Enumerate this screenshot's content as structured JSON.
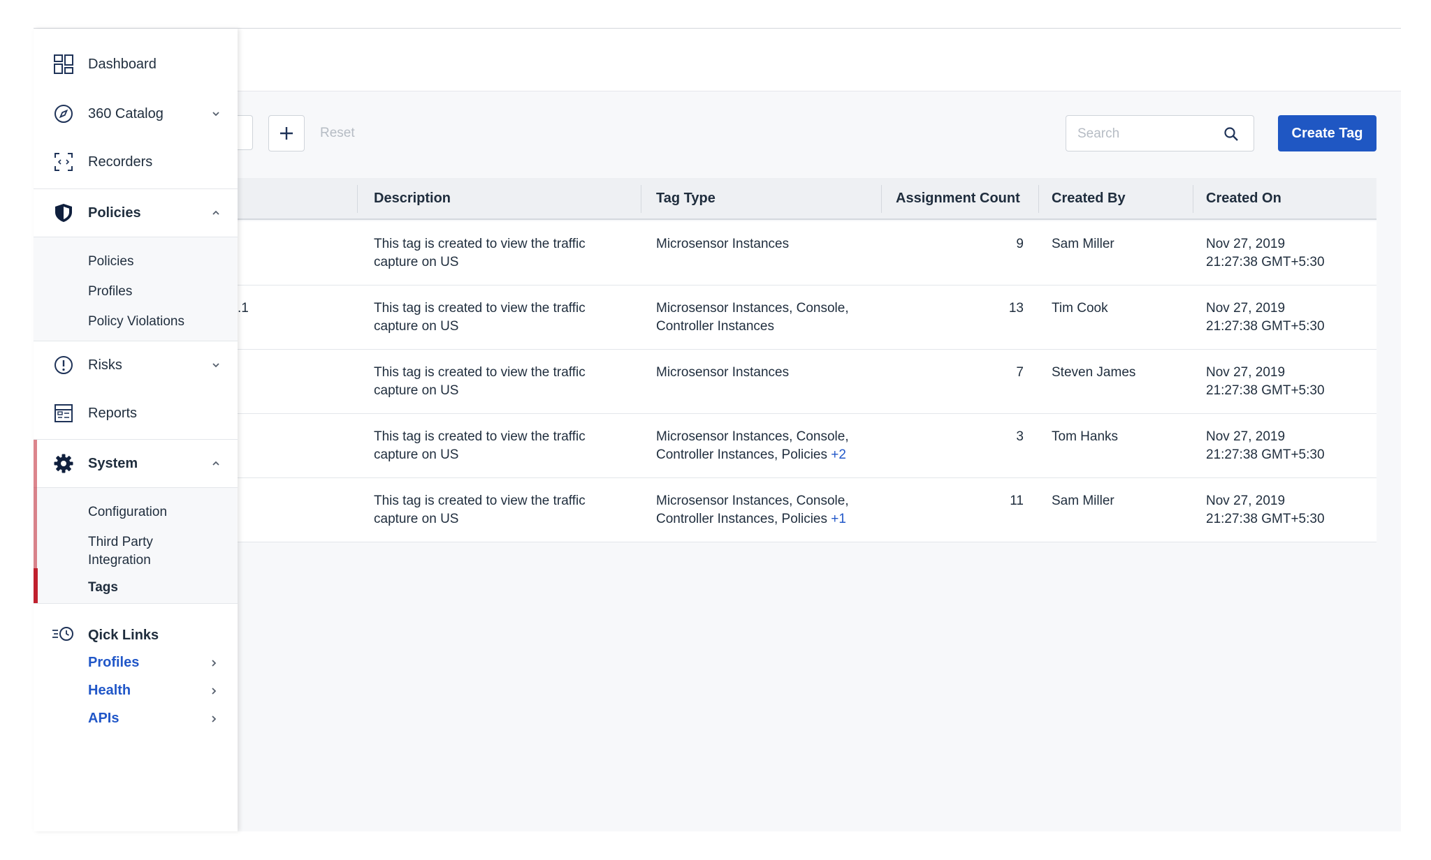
{
  "sidebar": {
    "items": [
      {
        "label": "Dashboard"
      },
      {
        "label": "360 Catalog"
      },
      {
        "label": "Recorders"
      },
      {
        "label": "Policies",
        "sub": [
          "Policies",
          "Profiles",
          "Policy Violations"
        ]
      },
      {
        "label": "Risks"
      },
      {
        "label": "Reports"
      },
      {
        "label": "System",
        "sub": [
          "Configuration",
          "Third Party",
          "Integration",
          "Tags"
        ]
      }
    ],
    "quick_links": {
      "title": "Qick Links",
      "items": [
        "Profiles",
        "Health",
        "APIs"
      ]
    }
  },
  "toolbar": {
    "reset_label": "Reset",
    "search_placeholder": "Search",
    "create_label": "Create Tag"
  },
  "table": {
    "columns": [
      "Description",
      "Tag Type",
      "Assignment Count",
      "Created By",
      "Created On"
    ],
    "rows": [
      {
        "frag": "",
        "desc1": "This tag is created to view the traffic",
        "desc2": "capture on US",
        "type1": "Microsensor Instances",
        "type2": "",
        "more": "",
        "count": "9",
        "by": "Sam Miller",
        "on1": "Nov 27, 2019",
        "on2": "21:27:38 GMT+5:30"
      },
      {
        "frag": ".1",
        "desc1": "This tag is created to view the traffic",
        "desc2": "capture on US",
        "type1": "Microsensor Instances, Console,",
        "type2": "Controller Instances",
        "more": "",
        "count": "13",
        "by": "Tim Cook",
        "on1": "Nov 27, 2019",
        "on2": "21:27:38 GMT+5:30"
      },
      {
        "frag": "",
        "desc1": "This tag is created to view the traffic",
        "desc2": "capture on US",
        "type1": "Microsensor Instances",
        "type2": "",
        "more": "",
        "count": "7",
        "by": "Steven James",
        "on1": "Nov 27, 2019",
        "on2": "21:27:38 GMT+5:30"
      },
      {
        "frag": "",
        "desc1": "This tag is created to view the traffic",
        "desc2": "capture on US",
        "type1": "Microsensor Instances, Console,",
        "type2": "Controller Instances, Policies",
        "more": "+2",
        "count": "3",
        "by": "Tom Hanks",
        "on1": "Nov 27, 2019",
        "on2": "21:27:38 GMT+5:30"
      },
      {
        "frag": "",
        "desc1": "This tag is created to view the traffic",
        "desc2": "capture on US",
        "type1": "Microsensor Instances, Console,",
        "type2": "Controller Instances, Policies",
        "more": "+1",
        "count": "11",
        "by": "Sam Miller",
        "on1": "Nov 27, 2019",
        "on2": "21:27:38 GMT+5:30"
      }
    ]
  },
  "colors": {
    "accent": "#1f57c3",
    "active_marker": "#c0202e",
    "link": "#2157c8"
  },
  "icons": {
    "dashboard": "dashboard-grid-icon",
    "catalog": "compass-icon",
    "recorders": "recorder-scan-icon",
    "policies": "shield-icon",
    "risks": "alert-circle-icon",
    "reports": "report-table-icon",
    "system": "gear-icon",
    "quick_links": "clock-list-icon",
    "search": "search-icon",
    "add": "plus-icon"
  }
}
